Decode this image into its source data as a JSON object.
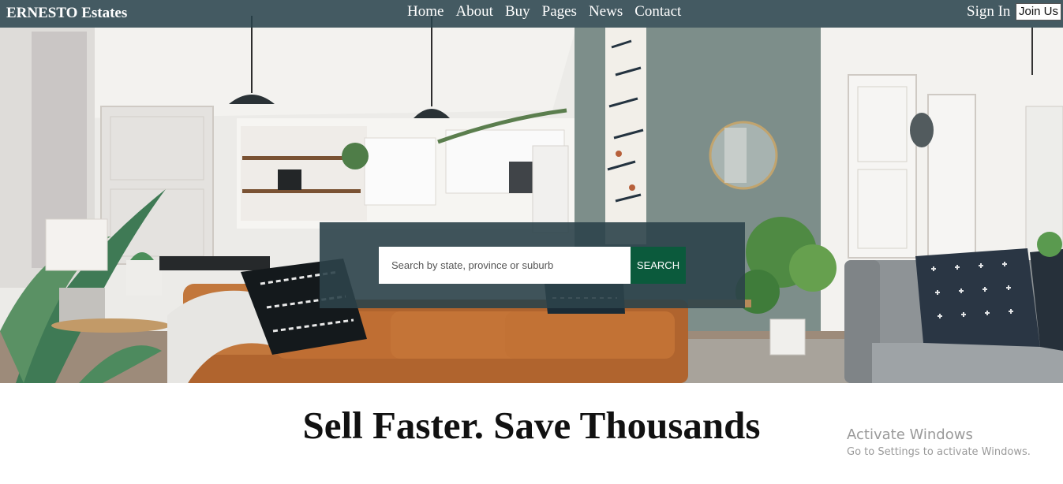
{
  "header": {
    "brand": "ERNESTO Estates",
    "nav": [
      "Home",
      "About",
      "Buy",
      "Pages",
      "News",
      "Contact"
    ],
    "sign_in": "Sign In",
    "join_us": "Join Us"
  },
  "search": {
    "placeholder": "Search by state, province or suburb",
    "value": "",
    "button_label": "SEARCH"
  },
  "main": {
    "headline": "Sell Faster. Save Thousands"
  },
  "watermark": {
    "title": "Activate Windows",
    "subtitle": "Go to Settings to activate Windows."
  },
  "colors": {
    "navbar": "#28424c",
    "search_panel": "#2c424a",
    "search_button": "#0b5a3c",
    "headline_text": "#111111",
    "watermark_text": "#9a9a9a"
  },
  "icons": [
    "interior-hero-image"
  ]
}
